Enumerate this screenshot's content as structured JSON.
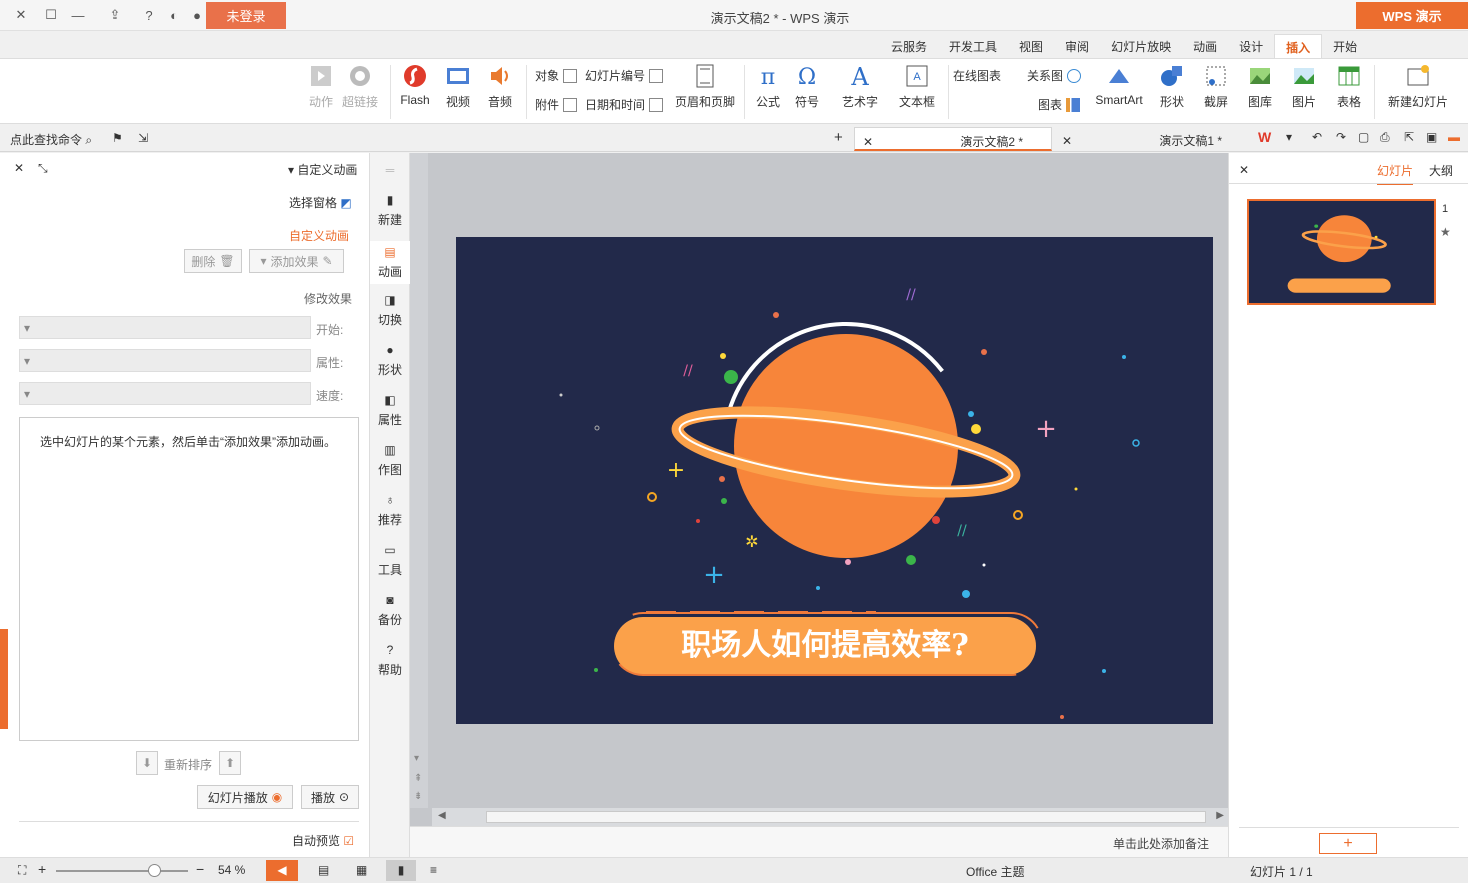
{
  "titlebar": {
    "title": "演示文稿2 * - WPS 演示",
    "login_label": "未登录",
    "app_button": "WPS 演示"
  },
  "menu_tabs": [
    "开始",
    "插入",
    "设计",
    "动画",
    "幻灯片放映",
    "审阅",
    "视图",
    "开发工具",
    "云服务"
  ],
  "ribbon": {
    "new_slide": "新建幻灯片",
    "table": "表格",
    "picture": "图片",
    "gallery": "图库",
    "screenshot": "截屏",
    "shape": "形状",
    "smartart": "SmartArt",
    "chart": "图表",
    "relation": "关系图",
    "online_chart": "在线图表",
    "textbox": "文本框",
    "wordart": "艺术字",
    "symbol": "符号",
    "formula": "公式",
    "header_footer": "页眉和页脚",
    "slide_number": "幻灯片编号",
    "date_time": "日期和时间",
    "object": "对象",
    "attachment": "附件",
    "audio": "音频",
    "video": "视频",
    "flash": "Flash",
    "hyperlink": "超链接",
    "action": "动作"
  },
  "tabbar": {
    "search_label": "点此查找命令",
    "doc1": "演示文稿1 *",
    "doc2": "演示文稿2 *"
  },
  "taskpane": {
    "title": "自定义动画",
    "select_pane": "选择窗格",
    "section": "自定义动画",
    "add_effect": "添加效果",
    "delete": "删除",
    "modify_effect": "修改效果",
    "start_label": "开始:",
    "property_label": "属性:",
    "speed_label": "速度:",
    "hint": "选中幻灯片的某个元素，然后单击“添加效果”添加动画。",
    "reorder": "重新排序",
    "play": "播放",
    "slideshow": "幻灯片播放",
    "autopreview": "自动预览"
  },
  "side_tools": [
    "新建",
    "动画",
    "切换",
    "形状",
    "属性",
    "作图",
    "推荐",
    "工具",
    "备份",
    "帮助"
  ],
  "slide": {
    "banner_text": "职场人如何提高效率?"
  },
  "right_panel": {
    "tab_slides": "幻灯片",
    "tab_outline": "大纲",
    "slide_number": "1"
  },
  "notes_placeholder": "单击此处添加备注",
  "statusbar": {
    "slide_info": "幻灯片 1 / 1",
    "theme": "Office 主题",
    "zoom": "54 %"
  },
  "colors": {
    "accent": "#ec6d2e",
    "slide_bg": "#22294a",
    "planet": "#f7853a",
    "banner": "#fba14a"
  }
}
